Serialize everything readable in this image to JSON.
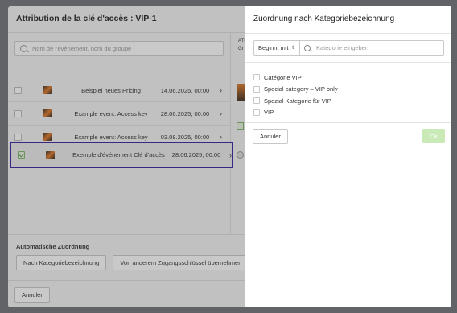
{
  "background_modal": {
    "title": "Attribution de la clé d'accès : VIP-1",
    "search_placeholder": "Nom de l'événement, nom du groupe",
    "events": [
      {
        "name": "Beispiel neues Pricing",
        "date": "14.06.2025, 00:00",
        "selected": false
      },
      {
        "name": "Example event: Access key",
        "date": "28.06.2025, 00:00",
        "selected": false
      },
      {
        "name": "Example event: Access key",
        "date": "03.08.2025, 00:00",
        "selected": false
      },
      {
        "name": "Exemple d'événement Clé d'accès",
        "date": "28.06.2025, 00:00",
        "selected": true
      }
    ],
    "right_fragment_lines": [
      "ATI",
      "Gr"
    ],
    "auto_section_title": "Automatische Zuordnung",
    "auto_buttons": [
      "Nach Kategoriebezeichnung",
      "Von anderem Zugangsschlüssel übernehmen"
    ],
    "footer_cancel": "Annuler"
  },
  "panel": {
    "title": "Zuordnung nach Kategoriebezeichnung",
    "match_select_value": "Beginnt mit",
    "category_input_placeholder": "Kategorie eingeben",
    "categories": [
      "Catégorie VIP",
      "Special category – VIP only",
      "Spezial Kategorie für VIP",
      "VIP"
    ],
    "cancel_label": "Annuler",
    "ok_label": "Ok"
  },
  "icons": {
    "chevron": "chevron-right-icon",
    "search": "search-icon",
    "select_arrows": "sort-arrows-icon"
  },
  "colors": {
    "selected_outline": "#3b1f9e",
    "ok_disabled": "#c9eab7",
    "check_green": "#5aa14a"
  }
}
